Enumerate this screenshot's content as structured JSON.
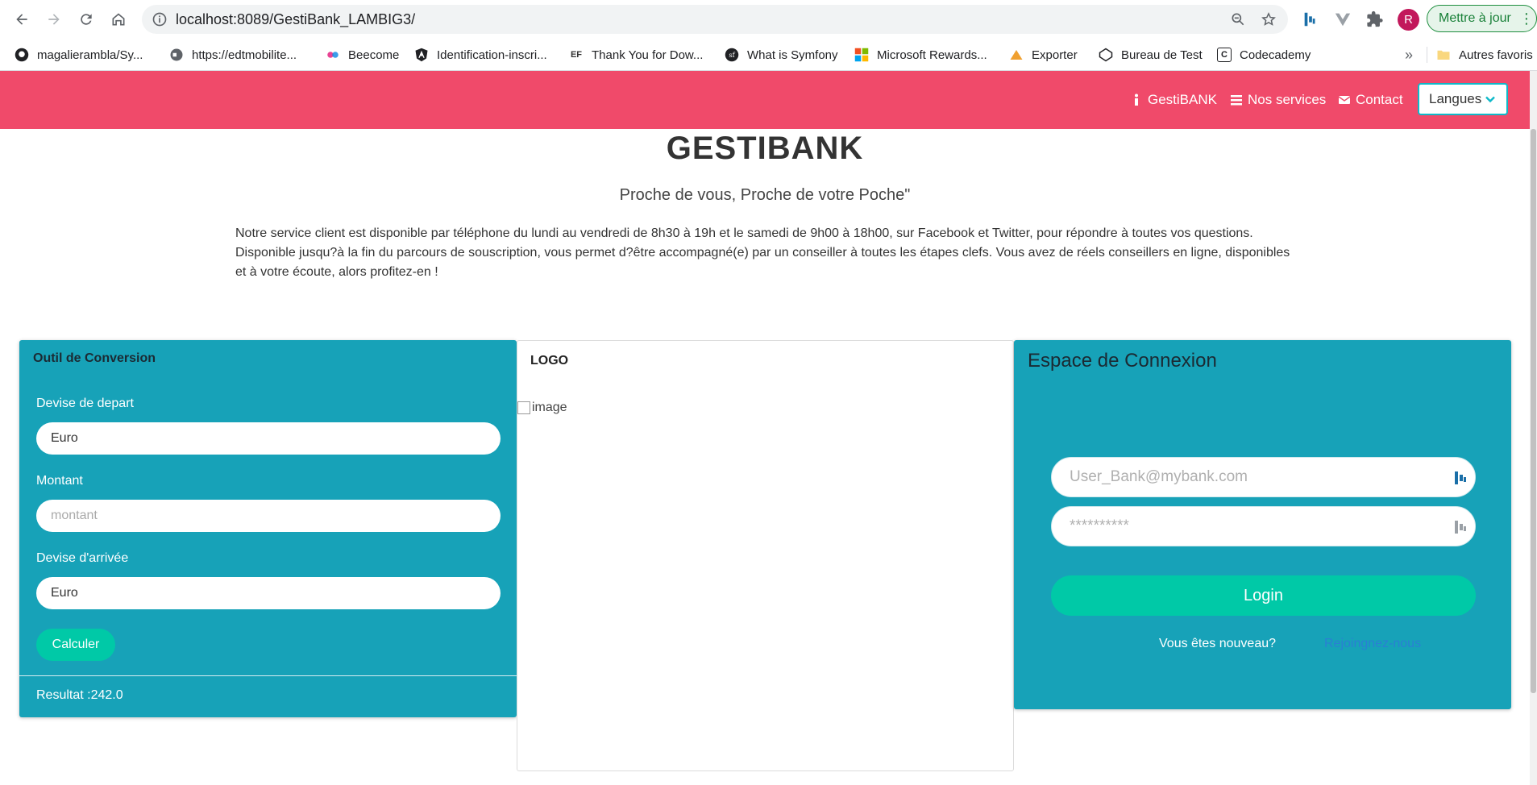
{
  "browser": {
    "url": "localhost:8089/GestiBank_LAMBIG3/",
    "update_label": "Mettre à jour",
    "profile_initial": "R",
    "bookmarks": [
      {
        "label": "magalierambla/Sy...",
        "icon": "github-icon"
      },
      {
        "label": "https://edtmobilite...",
        "icon": "globe-icon"
      },
      {
        "label": "Beecome",
        "icon": "beecome-icon"
      },
      {
        "label": "Identification-inscri...",
        "icon": "angular-icon"
      },
      {
        "label": "Thank You for Dow...",
        "icon": "ef-icon"
      },
      {
        "label": "What is Symfony",
        "icon": "symfony-icon"
      },
      {
        "label": "Microsoft Rewards...",
        "icon": "microsoft-icon"
      },
      {
        "label": "Exporter",
        "icon": "pma-icon"
      },
      {
        "label": "Bureau de Test",
        "icon": "codepen-icon"
      },
      {
        "label": "Codecademy",
        "icon": "codecademy-icon"
      }
    ],
    "more_bookmarks": "»",
    "other_favorites": "Autres favoris"
  },
  "navbar": {
    "links": [
      {
        "label": "GestiBANK",
        "icon": "info-icon"
      },
      {
        "label": "Nos services",
        "icon": "list-icon"
      },
      {
        "label": "Contact",
        "icon": "envelope-icon"
      }
    ],
    "language_label": "Langues"
  },
  "hero": {
    "title": "GESTIBANK",
    "subtitle": "Proche de vous, Proche de votre Poche\"",
    "description": "Notre service client est disponible par téléphone du lundi au vendredi de 8h30 à 19h et le samedi de 9h00 à 18h00, sur Facebook et Twitter, pour répondre à toutes vos questions. Disponible jusqu?à la fin du parcours de souscription, vous permet d?être accompagné(e) par un conseiller à toutes les étapes clefs. Vous avez de réels conseillers en ligne, disponibles et à votre écoute, alors profitez-en !"
  },
  "converter": {
    "title": "Outil de Conversion",
    "from_label": "Devise de depart",
    "from_value": "Euro",
    "amount_label": "Montant",
    "amount_placeholder": "montant",
    "to_label": "Devise d'arrivée",
    "to_value": "Euro",
    "calculate_label": "Calculer",
    "result": "Resultat :242.0"
  },
  "logo_panel": {
    "title": "LOGO",
    "image_alt": "image"
  },
  "login": {
    "title": "Espace de Connexion",
    "email_placeholder": "User_Bank@mybank.com",
    "password_placeholder": "**********",
    "login_label": "Login",
    "new_user_text": "Vous êtes nouveau?",
    "join_link": "Rejoingnez-nous"
  },
  "colors": {
    "navbar": "#f04a6a",
    "panel": "#17a2b8",
    "button": "#00c9a7"
  }
}
